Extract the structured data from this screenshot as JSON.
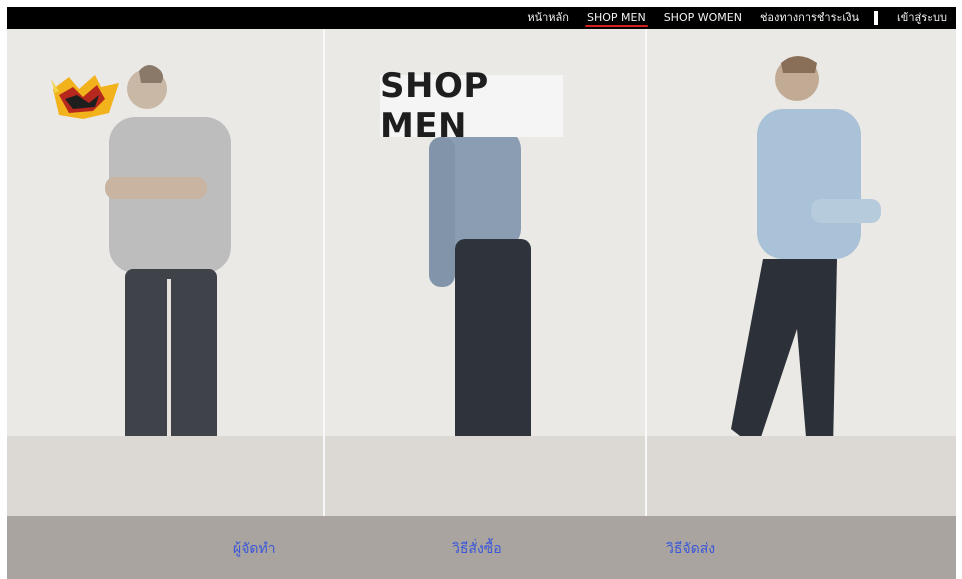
{
  "nav": {
    "items": [
      {
        "label": "หน้าหลัก",
        "active": false
      },
      {
        "label": "SHOP MEN",
        "active": true
      },
      {
        "label": "SHOP WOMEN",
        "active": false
      },
      {
        "label": "ช่องทางการชำระเงิน",
        "active": false
      }
    ],
    "login_label": "เข้าสู่ระบบ"
  },
  "hero": {
    "title": "SHOP MEN",
    "logo_icon": "brand-logo-icon"
  },
  "footer": {
    "links": [
      {
        "label": "ผู้จัดทำ"
      },
      {
        "label": "วิธีสั่งซื้อ"
      },
      {
        "label": "วิธีจัดส่ง"
      }
    ]
  },
  "colors": {
    "topbar_bg": "#000000",
    "active_underline": "#d21f1f",
    "footer_bg": "#a9a4a0",
    "footer_link": "#3b57d9"
  }
}
